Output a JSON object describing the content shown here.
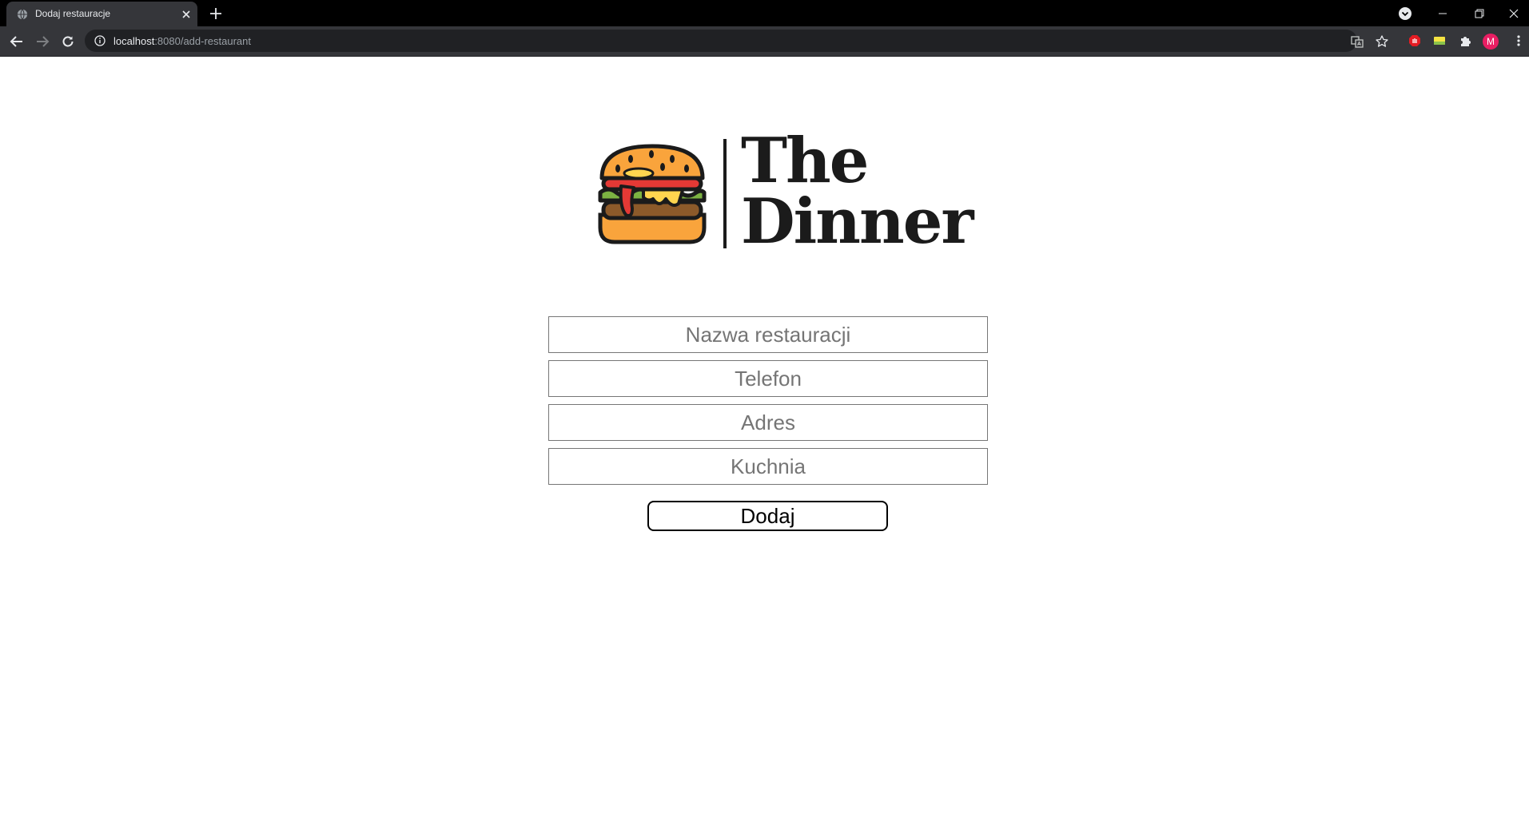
{
  "browser": {
    "tab_title": "Dodaj restauracje",
    "url_host": "localhost",
    "url_rest": ":8080/add-restaurant",
    "profile_initial": "M"
  },
  "logo": {
    "line1": "The",
    "line2": "Dinner"
  },
  "form": {
    "name_placeholder": "Nazwa restauracji",
    "phone_placeholder": "Telefon",
    "address_placeholder": "Adres",
    "cuisine_placeholder": "Kuchnia",
    "submit_label": "Dodaj"
  },
  "colors": {
    "chrome_dark": "#000000",
    "chrome_toolbar": "#35363a",
    "avatar": "#e91e63"
  }
}
